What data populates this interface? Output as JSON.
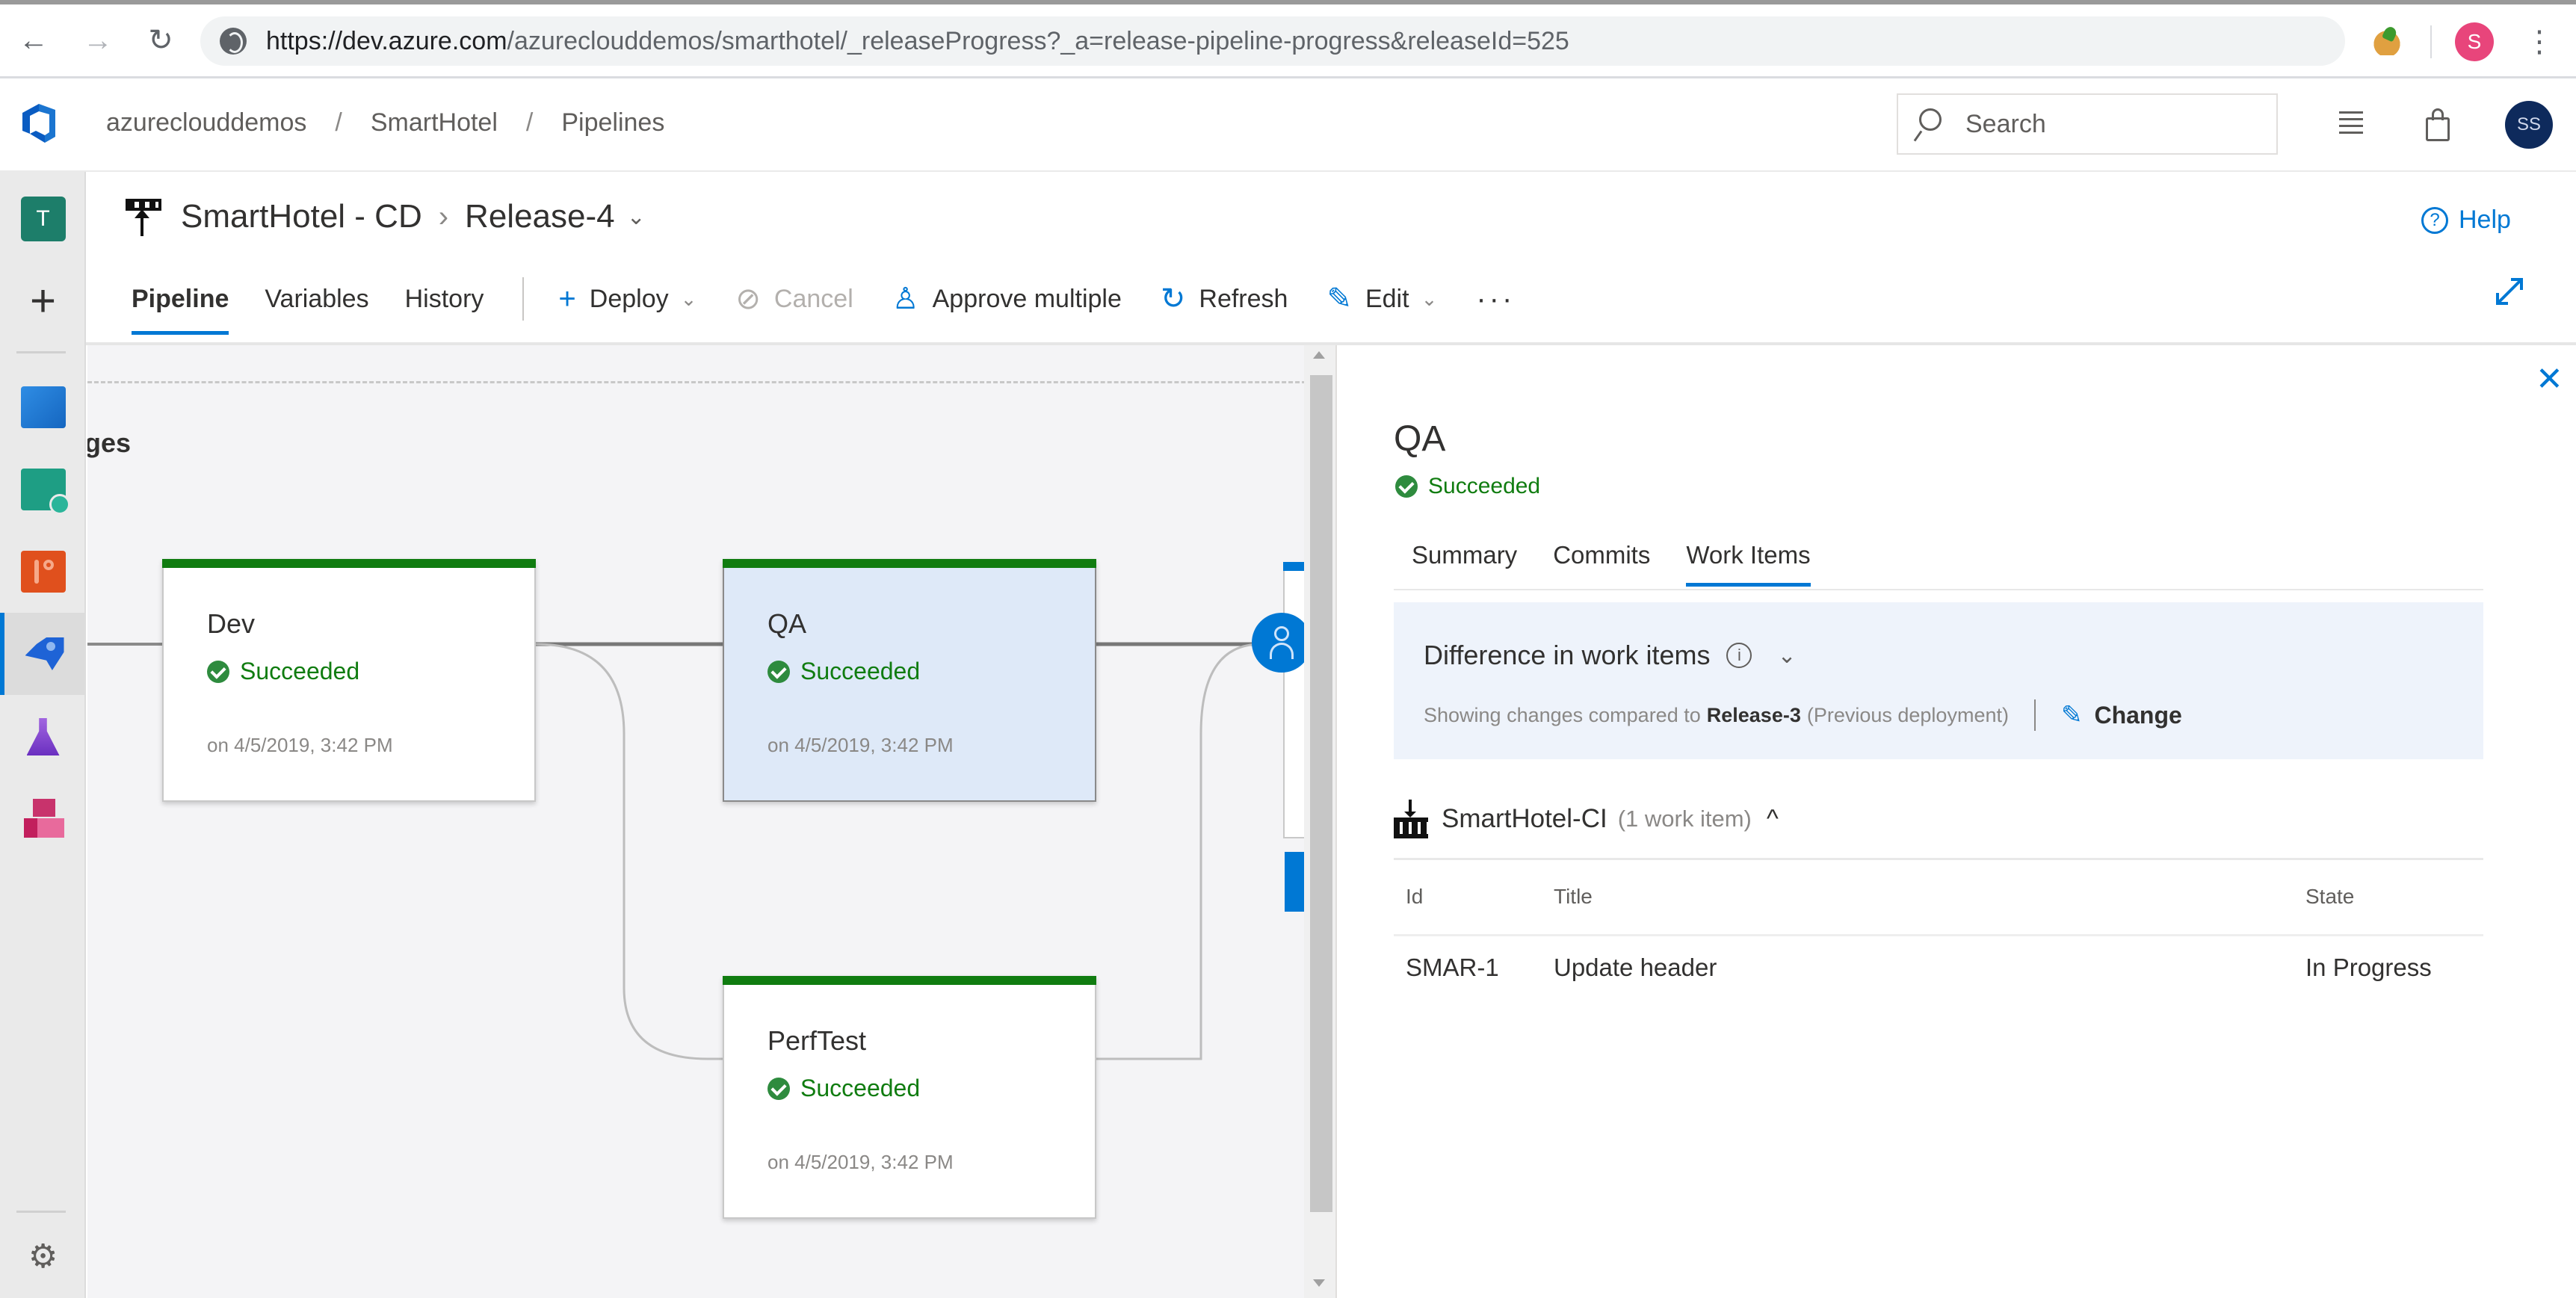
{
  "browser": {
    "back_icon": "arrow-left-icon",
    "forward_icon": "arrow-right-icon",
    "reload_icon": "reload-icon",
    "url_host": "https://dev.azure.com",
    "url_path": "/azureclouddemos/smarthotel/_releaseProgress?_a=release-pipeline-progress&releaseId=525",
    "profile_initial": "S",
    "menu_icon": "⋮"
  },
  "header": {
    "breadcrumb": [
      "azureclouddemos",
      "SmartHotel",
      "Pipelines"
    ],
    "breadcrumb_sep": "/",
    "search_placeholder": "Search",
    "user_initials": "SS"
  },
  "rail": {
    "project_initial": "T",
    "add_label": "+",
    "items": [
      "Overview",
      "Boards",
      "Repos",
      "Pipelines",
      "Test Plans",
      "Artifacts"
    ],
    "active": "Pipelines",
    "settings_icon": "⚙"
  },
  "page": {
    "definition_name": "SmartHotel - CD",
    "release_name": "Release-4",
    "chevron_right": "›",
    "chevron_down": "⌄",
    "help_label": "Help"
  },
  "toolbar": {
    "tabs": [
      {
        "label": "Pipeline",
        "selected": true
      },
      {
        "label": "Variables",
        "selected": false
      },
      {
        "label": "History",
        "selected": false
      }
    ],
    "actions": {
      "deploy": "Deploy",
      "cancel": "Cancel",
      "approve_multiple": "Approve multiple",
      "refresh": "Refresh",
      "edit": "Edit",
      "more": "···"
    }
  },
  "canvas": {
    "section_heading": "ges",
    "stages": [
      {
        "name": "Dev",
        "status": "Succeeded",
        "time": "on 4/5/2019, 3:42 PM",
        "selected": false
      },
      {
        "name": "QA",
        "status": "Succeeded",
        "time": "on 4/5/2019, 3:42 PM",
        "selected": true
      },
      {
        "name": "PerfTest",
        "status": "Succeeded",
        "time": "on 4/5/2019, 3:42 PM",
        "selected": false
      }
    ],
    "colors": {
      "success": "#107c10",
      "accent": "#0078d4"
    }
  },
  "panel": {
    "close_label": "✕",
    "stage_name": "QA",
    "stage_status": "Succeeded",
    "tabs": [
      {
        "label": "Summary",
        "selected": false
      },
      {
        "label": "Commits",
        "selected": false
      },
      {
        "label": "Work Items",
        "selected": true
      }
    ],
    "difference": {
      "title": "Difference in work items",
      "info_icon": "i",
      "chevron": "⌄",
      "compare_prefix": "Showing changes compared to",
      "compare_release": "Release-3",
      "compare_suffix": "(Previous deployment)",
      "change_label": "Change"
    },
    "artifact": {
      "name": "SmartHotel-CI",
      "count": "(1 work item)",
      "caret": "^"
    },
    "work_items": {
      "columns": [
        "Id",
        "Title",
        "State"
      ],
      "rows": [
        {
          "id": "SMAR-1",
          "title": "Update header",
          "state": "In Progress"
        }
      ]
    }
  }
}
